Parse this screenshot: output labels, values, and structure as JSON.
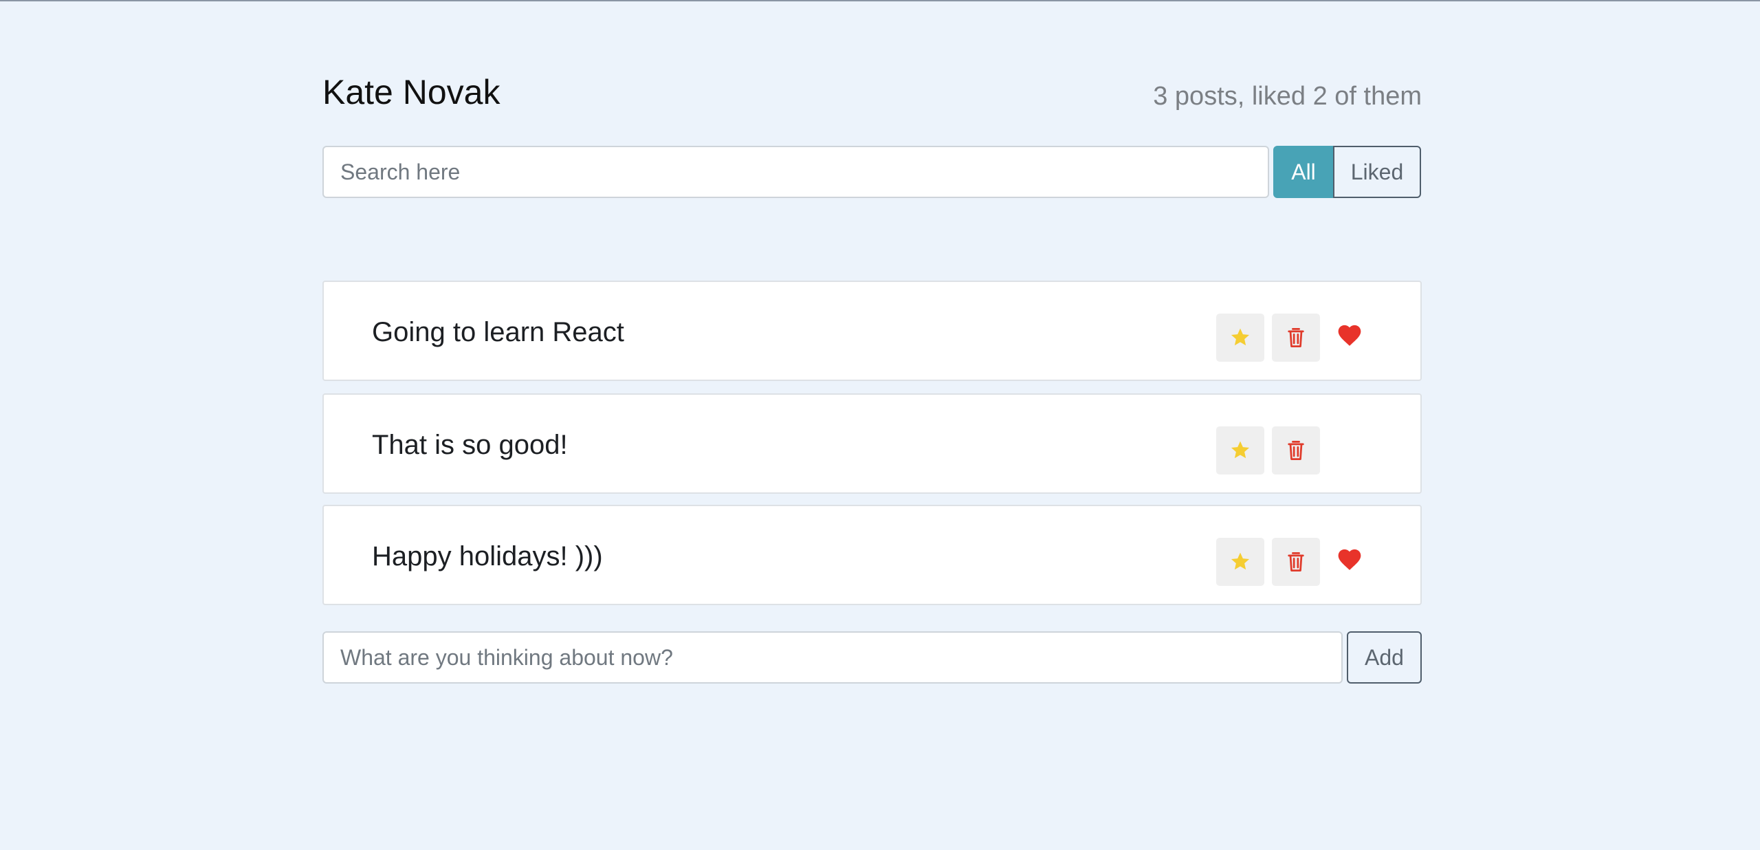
{
  "header": {
    "title": "Kate Novak",
    "counter": "3 posts, liked 2 of them"
  },
  "search": {
    "placeholder": "Search here"
  },
  "filters": {
    "all_label": "All",
    "liked_label": "Liked",
    "active": "All"
  },
  "posts": [
    {
      "label": "Going to learn React",
      "liked": true
    },
    {
      "label": "That is so good!",
      "liked": false
    },
    {
      "label": "Happy holidays! )))",
      "liked": true
    }
  ],
  "icons": {
    "star": "star-icon",
    "trash": "trash-icon",
    "heart": "heart-icon"
  },
  "colors": {
    "background": "#ecf3fb",
    "accent": "#48a3b6",
    "star": "#f5cd32",
    "trash": "#e03a2a",
    "heart": "#e8332a"
  },
  "add_form": {
    "placeholder": "What are you thinking about now?",
    "button_label": "Add"
  }
}
